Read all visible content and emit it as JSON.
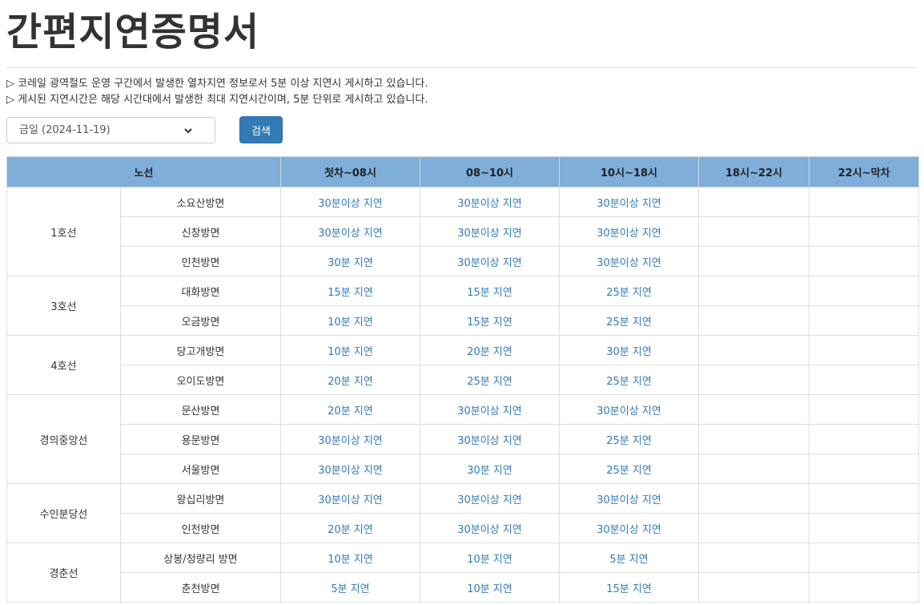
{
  "page": {
    "title": "간편지연증명서",
    "notices": [
      "▷ 코레일 광역철도 운영 구간에서 발생한 열차지연 정보로서 5분 이상 지연시 게시하고 있습니다.",
      "▷ 게시된 지연시간은 해당 시간대에서 발생한 최대 지연시간이며, 5분 단위로 게시하고 있습니다."
    ]
  },
  "search": {
    "selected_date": "금일 (2024-11-19)",
    "button_label": "검색"
  },
  "table": {
    "headers": [
      "노선",
      "첫차~08시",
      "08~10시",
      "10시~18시",
      "18시~22시",
      "22시~막차"
    ],
    "lines": [
      {
        "name": "1호선",
        "directions": [
          {
            "dir": "소요산방면",
            "cells": [
              "30분이상 지연",
              "30분이상 지연",
              "30분이상 지연",
              "",
              ""
            ]
          },
          {
            "dir": "신창방면",
            "cells": [
              "30분이상 지연",
              "30분이상 지연",
              "30분이상 지연",
              "",
              ""
            ]
          },
          {
            "dir": "인천방면",
            "cells": [
              "30분 지연",
              "30분이상 지연",
              "30분이상 지연",
              "",
              ""
            ]
          }
        ]
      },
      {
        "name": "3호선",
        "directions": [
          {
            "dir": "대화방면",
            "cells": [
              "15분 지연",
              "15분 지연",
              "25분 지연",
              "",
              ""
            ]
          },
          {
            "dir": "오금방면",
            "cells": [
              "10분 지연",
              "15분 지연",
              "25분 지연",
              "",
              ""
            ]
          }
        ]
      },
      {
        "name": "4호선",
        "directions": [
          {
            "dir": "당고개방면",
            "cells": [
              "10분 지연",
              "20분 지연",
              "30분 지연",
              "",
              ""
            ]
          },
          {
            "dir": "오이도방면",
            "cells": [
              "20분 지연",
              "25분 지연",
              "25분 지연",
              "",
              ""
            ]
          }
        ]
      },
      {
        "name": "경의중앙선",
        "directions": [
          {
            "dir": "문산방면",
            "cells": [
              "20분 지연",
              "30분이상 지연",
              "30분이상 지연",
              "",
              ""
            ]
          },
          {
            "dir": "용문방면",
            "cells": [
              "30분이상 지연",
              "30분이상 지연",
              "25분 지연",
              "",
              ""
            ]
          },
          {
            "dir": "서울방면",
            "cells": [
              "30분이상 지연",
              "30분 지연",
              "25분 지연",
              "",
              ""
            ]
          }
        ]
      },
      {
        "name": "수인분당선",
        "directions": [
          {
            "dir": "왕십리방면",
            "cells": [
              "30분이상 지연",
              "30분이상 지연",
              "30분이상 지연",
              "",
              ""
            ]
          },
          {
            "dir": "인천방면",
            "cells": [
              "20분 지연",
              "30분이상 지연",
              "30분이상 지연",
              "",
              ""
            ]
          }
        ]
      },
      {
        "name": "경춘선",
        "directions": [
          {
            "dir": "상봉/청량리 방면",
            "cells": [
              "10분 지연",
              "10분 지연",
              "5분 지연",
              "",
              ""
            ]
          },
          {
            "dir": "춘천방면",
            "cells": [
              "5분 지연",
              "10분 지연",
              "15분 지연",
              "",
              ""
            ]
          }
        ]
      }
    ]
  }
}
